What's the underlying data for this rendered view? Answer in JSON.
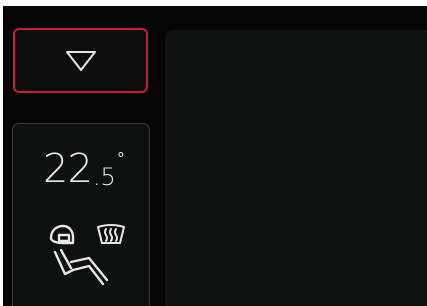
{
  "sidebar": {
    "collapse_button": {
      "icon": "triangle-down-icon",
      "accent_color": "#c8202a"
    },
    "climate": {
      "temperature_integer": "22",
      "temperature_decimal": ".5",
      "temperature_unit": "°",
      "icons": [
        "seat-heating-icon",
        "rear-defrost-icon"
      ]
    }
  }
}
